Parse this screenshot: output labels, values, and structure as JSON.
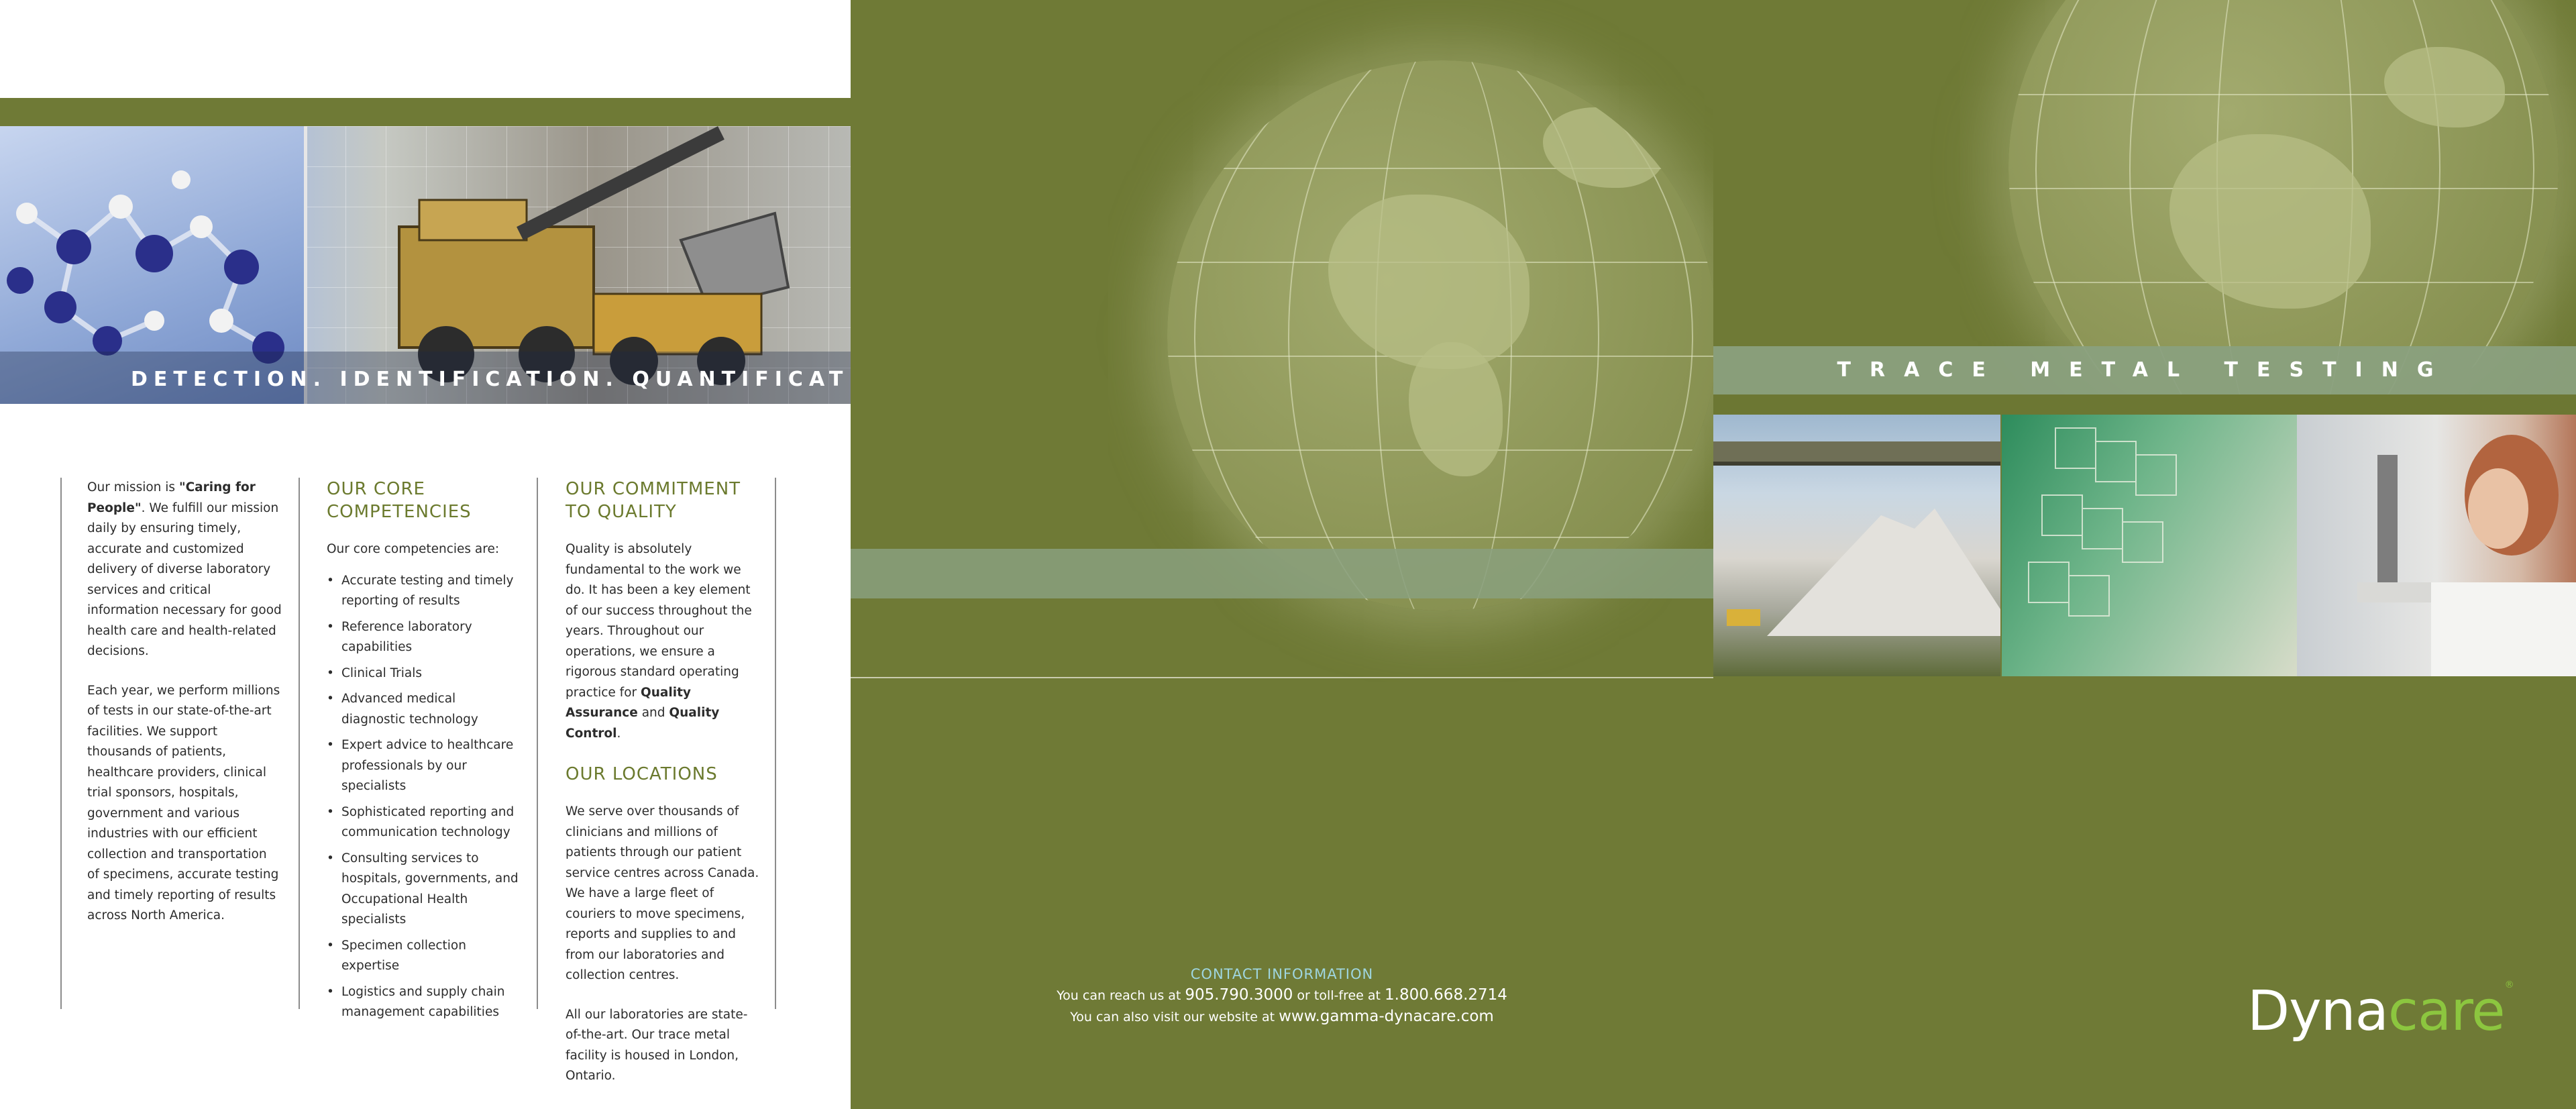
{
  "left": {
    "tagline": "DETECTION. IDENTIFICATION. QUANTIFICATION.",
    "mission": {
      "lead": "Our mission is ",
      "emphasis": "\"Caring for People\"",
      "rest": ". We fulfill our mission daily by ensuring timely, accurate and customized delivery of diverse laboratory services and critical information necessary for good health care and health-related decisions.",
      "para2": "Each year, we perform millions of tests in our state-of-the-art facilities. We support thousands of patients, healthcare providers, clinical trial sponsors, hospitals, government and various industries with our efficient collection and transportation of specimens, accurate testing and timely reporting of results across North America."
    },
    "competencies": {
      "heading": "OUR CORE COMPETENCIES",
      "intro": "Our core competencies are:",
      "items": [
        "Accurate testing and timely reporting of results",
        "Reference laboratory capabilities",
        "Clinical Trials",
        "Advanced medical diagnostic technology",
        "Expert advice to healthcare professionals by our specialists",
        "Sophisticated reporting and communication technology",
        "Consulting services to hospitals, governments, and Occupational Health specialists",
        "Specimen collection expertise",
        "Logistics and supply chain management capabilities"
      ]
    },
    "commitment": {
      "heading": "OUR COMMITMENT TO QUALITY",
      "text1": "Quality is absolutely fundamental to the work we do. It has been a key element of our success throughout the years. Throughout our operations, we ensure a rigorous standard operating practice for ",
      "bold1": "Quality Assurance",
      "text2": " and ",
      "bold2": "Quality Control",
      "text3": "."
    },
    "locations": {
      "heading": "OUR LOCATIONS",
      "para1": "We serve over thousands of clinicians and millions of patients through our patient service centres across Canada. We have a large fleet of couriers to move specimens, reports and supplies to and from our laboratories and collection centres.",
      "para2": "All our laboratories are state-of-the-art. Our trace metal facility is housed in London, Ontario."
    }
  },
  "middle": {
    "contact_title": "CONTACT INFORMATION",
    "line1_pre": "You can reach us at ",
    "phone": "905.790.3000",
    "line1_mid": " or toll-free at ",
    "tollfree": "1.800.668.2714",
    "line2_pre": "You can also visit our website at ",
    "website": "www.gamma-dynacare.com"
  },
  "right": {
    "title": "TRACE METAL TESTING",
    "logo_part1": "Dyna",
    "logo_part2": "care",
    "logo_mark": "®"
  },
  "colors": {
    "olive": "#6f7a36",
    "heading_green": "#6b7a2e",
    "stripe": "#8aa07e",
    "logo_green": "#8cc63f",
    "contact_cyan": "#9fd6e0"
  }
}
